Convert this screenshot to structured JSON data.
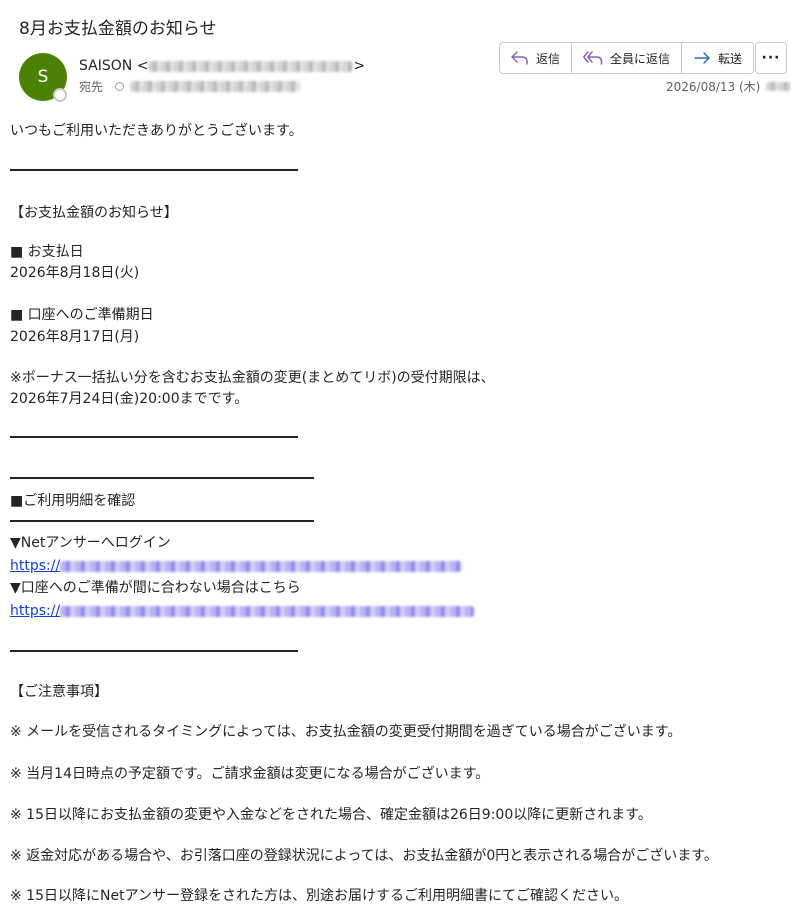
{
  "email": {
    "subject": "8月お支払金額のお知らせ",
    "avatar_initial": "S",
    "sender_name": "SAISON",
    "sender_open": "<",
    "sender_close": ">",
    "to_label": "宛先",
    "date": "2026/08/13 (木)",
    "avatar_color": "#498205"
  },
  "actions": {
    "reply": "返信",
    "reply_all": "全員に返信",
    "forward": "転送",
    "more": "···"
  },
  "body": {
    "greeting": "いつもご利用いただきありがとうございます。",
    "section_title": "【お支払金額のお知らせ】",
    "payment_day_heading": "■ お支払日",
    "payment_day_value": "2026年8月18日(火)",
    "prepare_heading": "■ 口座へのご準備期日",
    "prepare_value": "2026年8月17日(月)",
    "bonus_line1": "※ボーナス一括払い分を含むお支払金額の変更(まとめてリボ)の受付期限は、",
    "bonus_line2": "2026年7月24日(金)20:00までです。",
    "detail_heading": "■ご利用明細を確認",
    "net_answer_label": "▼Netアンサーへログイン",
    "link_prefix_1": "https://",
    "not_in_time_label": "▼口座へのご準備が間に合わない場合はこちら",
    "link_prefix_2": "https://",
    "notes_title": "【ご注意事項】",
    "notes": [
      "※ メールを受信されるタイミングによっては、お支払金額の変更受付期間を過ぎている場合がございます。",
      "※ 当月14日時点の予定額です。ご請求金額は変更になる場合がございます。",
      "※ 15日以降にお支払金額の変更や入金などをされた場合、確定金額は26日9:00以降に更新されます。",
      "※ 返金対応がある場合や、お引落口座の登録状況によっては、お支払金額が0円と表示される場合がございます。",
      "※ 15日以降にNetアンサー登録をされた方は、別途お届けするご利用明細書にてご確認ください。"
    ]
  }
}
